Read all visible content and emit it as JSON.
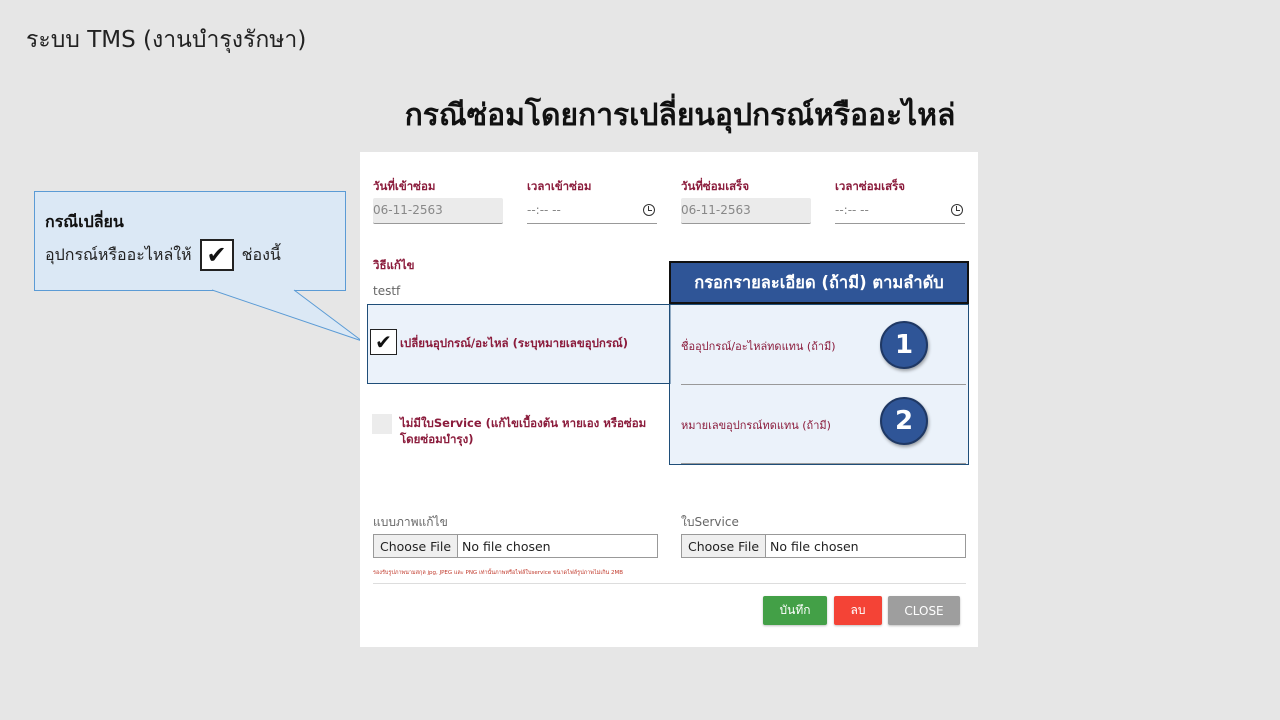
{
  "slide": {
    "header": "ระบบ TMS (งานบำรุงรักษา)",
    "title": "กรณีซ่อมโดยการเปลี่ยนอุปกรณ์หรืออะไหล่"
  },
  "callout": {
    "title": "กรณีเปลี่ยน",
    "line_before": "อุปกรณ์หรืออะไหล่ให้",
    "check_mark": "✔",
    "line_after": "ช่องนี้"
  },
  "form": {
    "repair_date_label": "วันที่เข้าซ่อม",
    "repair_date_value": "06-11-2563",
    "repair_time_label": "เวลาเข้าซ่อม",
    "repair_time_value": "--:-- --",
    "finish_date_label": "วันที่ซ่อมเสร็จ",
    "finish_date_value": "06-11-2563",
    "finish_time_label": "เวลาซ่อมเสร็จ",
    "finish_time_value": "--:-- --",
    "method_label": "วิธีแก้ไข",
    "method_value": "testf",
    "replace_check_mark": "✔",
    "replace_label": "เปลี่ยนอุปกรณ์/อะไหล่ (ระบุหมายเลขอุปกรณ์)",
    "no_service_label_line1": "ไม่มีใบService (แก้ไขเบื้องต้น หายเอง หรือซ่อม",
    "no_service_label_line2": "โดยซ่อมบำรุง)",
    "replacement_name_label": "ชื่ออุปกรณ์/อะไหล่ทดแทน (ถ้ามี)",
    "replacement_number_label": "หมายเลขอุปกรณ์ทดแทน (ถ้ามี)",
    "image_label": "แบบภาพแก้ไข",
    "service_label": "ใบService",
    "choose_file": "Choose File",
    "no_file": "No file chosen",
    "note": "รองรับรูปภาพนามสกุล jpg, JPEG และ PNG เท่านั้นภาพหรือไฟล์ใบservice ขนาดไฟล์รูปภาพไม่เกิน 2MB",
    "save_button": "บันทึก",
    "delete_button": "ลบ",
    "close_button": "CLOSE"
  },
  "annotation": {
    "header": "กรอกรายละเอียด (ถ้ามี) ตามลำดับ",
    "badge_1": "1",
    "badge_2": "2"
  },
  "colors": {
    "accent_blue": "#2f5597",
    "label_red": "#8b1c3c",
    "save_green": "#43a047",
    "delete_red": "#f44336",
    "close_grey": "#9e9e9e"
  }
}
